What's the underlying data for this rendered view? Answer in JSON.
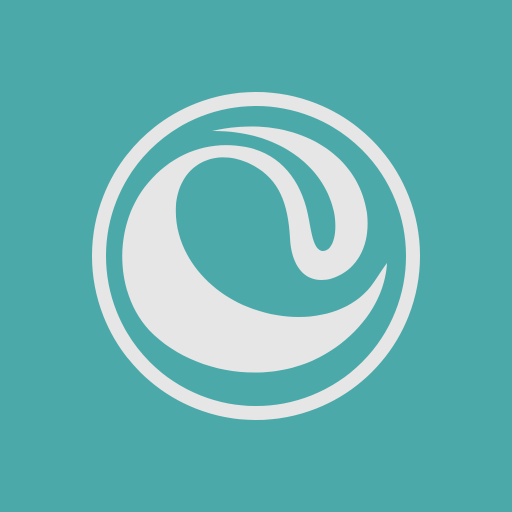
{
  "app_icon": {
    "icon": "swirl-emblem-icon",
    "colors": {
      "background": "#4BA9AA",
      "foreground": "#E6E6E6"
    }
  }
}
